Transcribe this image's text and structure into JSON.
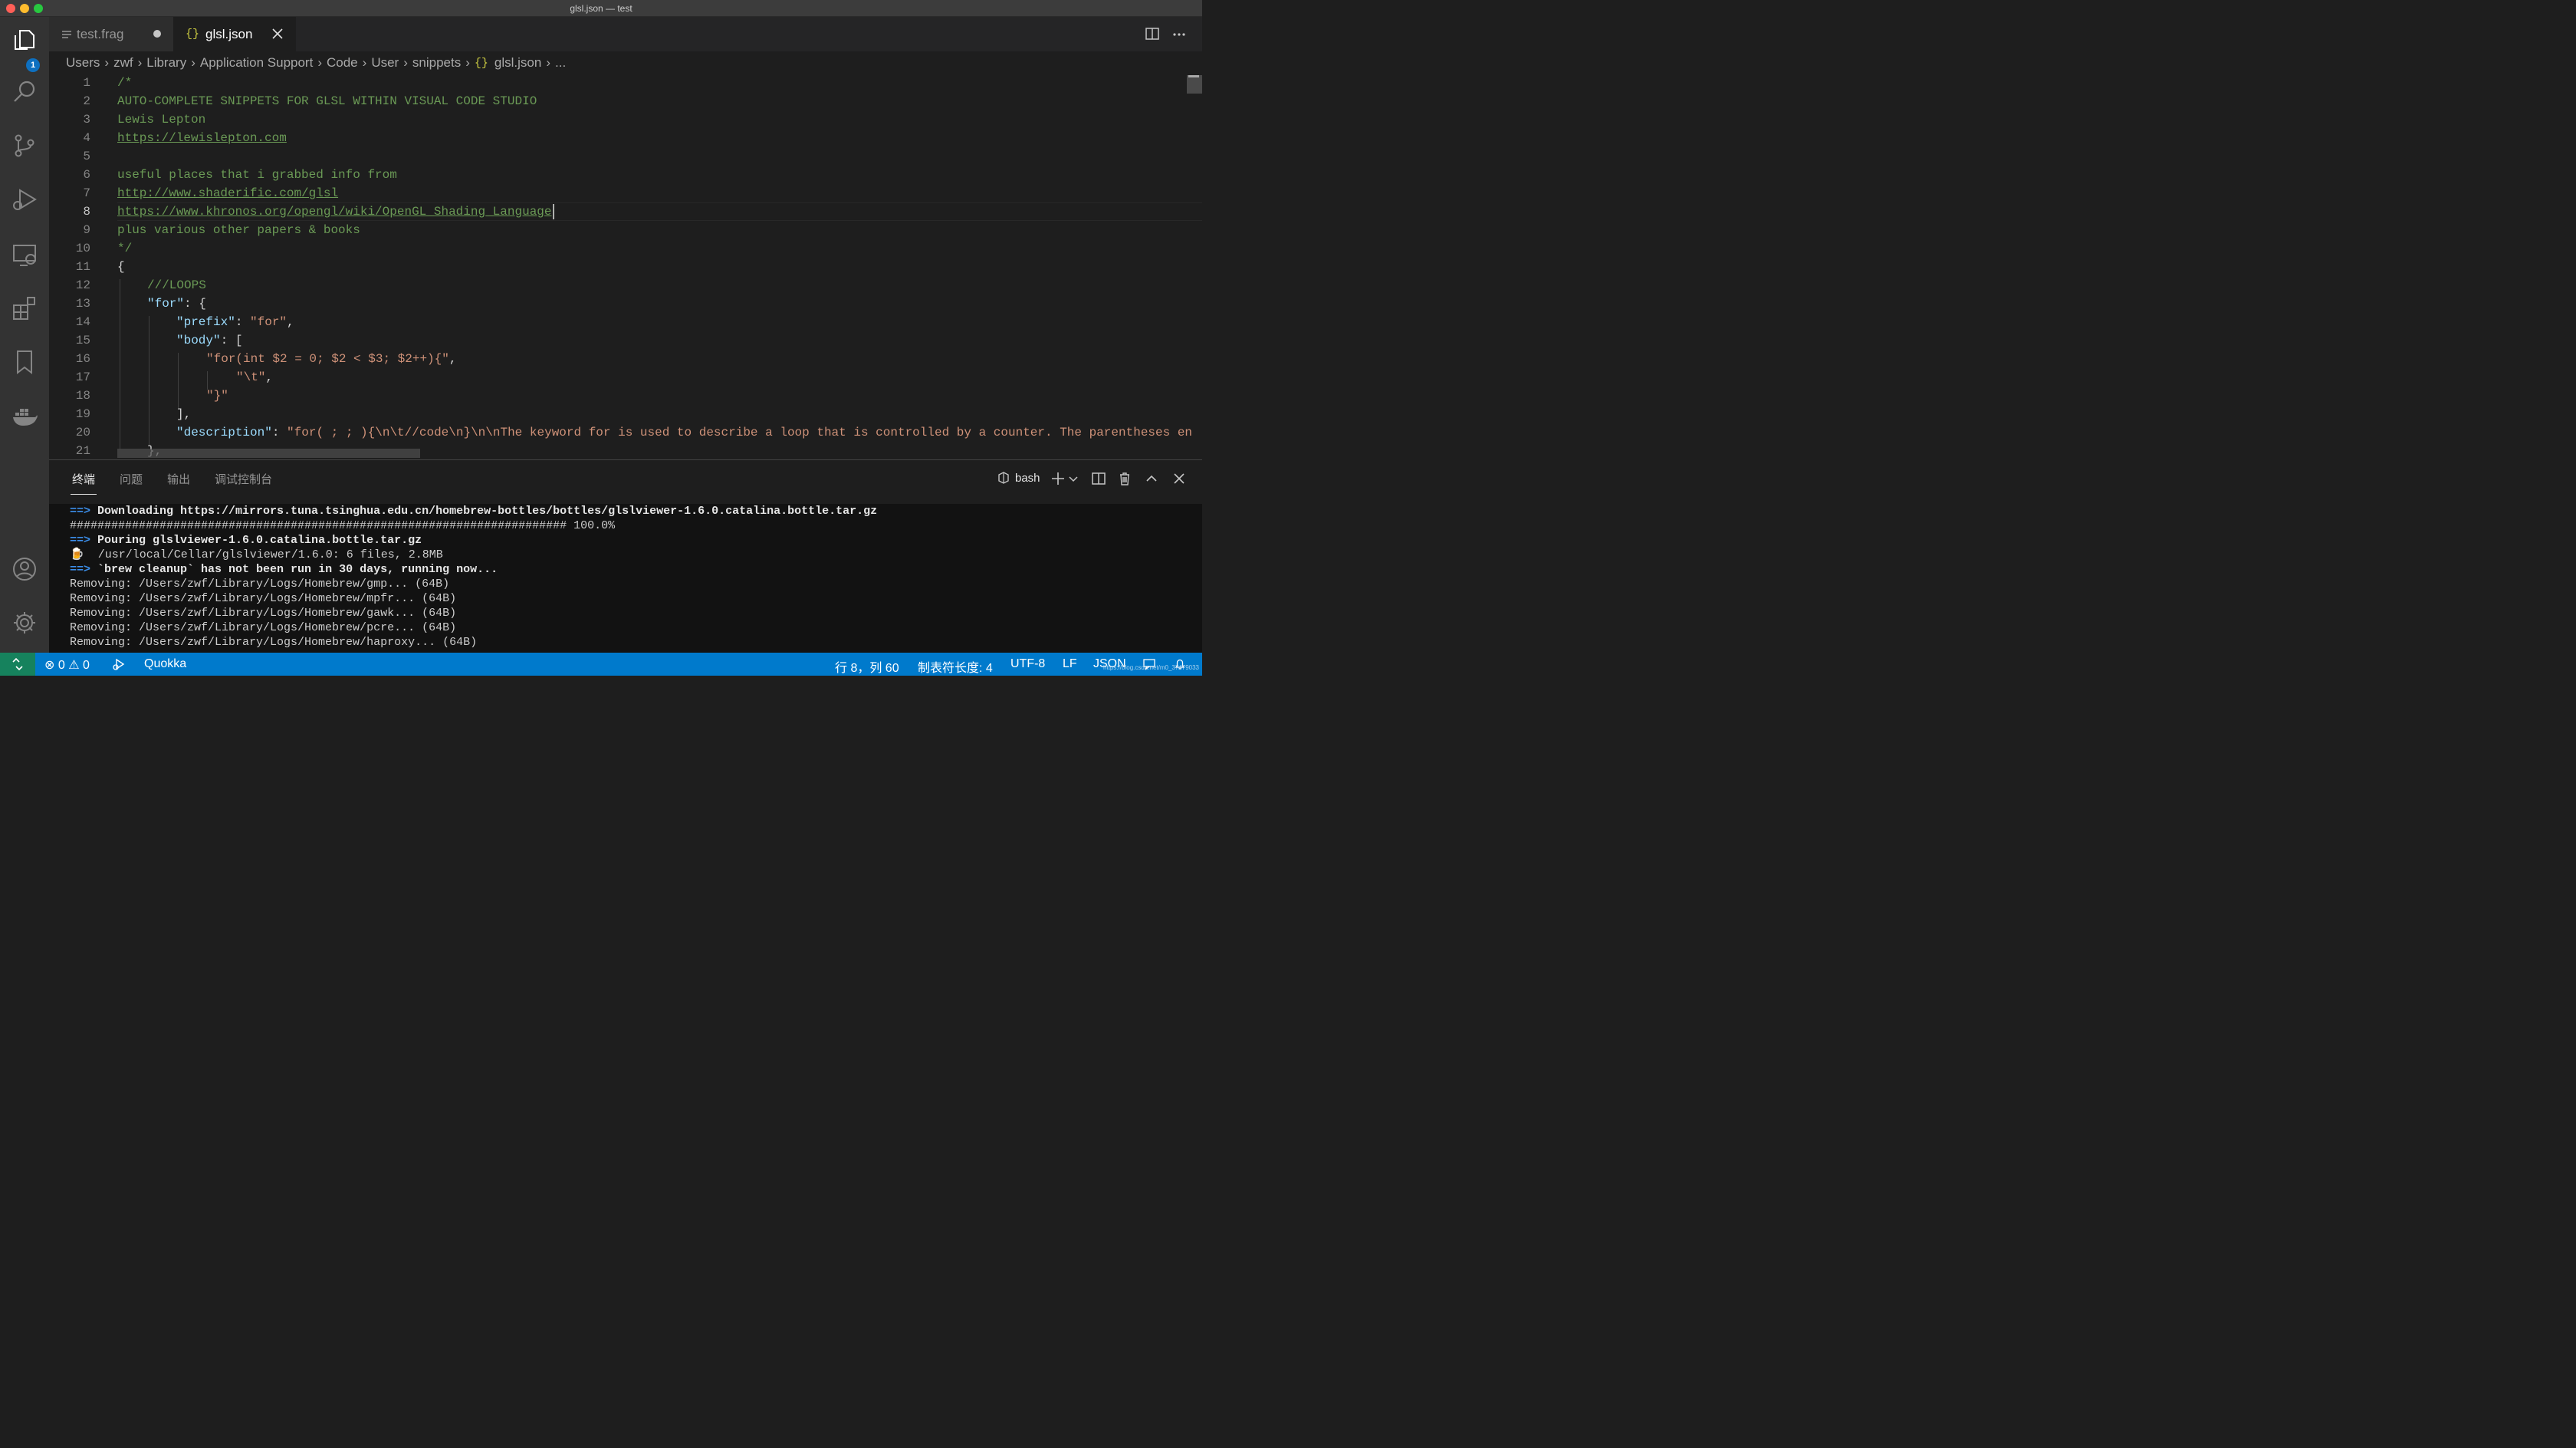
{
  "window": {
    "title": "glsl.json — test"
  },
  "activity_bar": {
    "explorer_badge": "1"
  },
  "tabs": [
    {
      "label": "test.frag",
      "icon": "lines-icon",
      "modified": true
    },
    {
      "label": "glsl.json",
      "icon": "braces-icon",
      "active": true
    }
  ],
  "breadcrumb": {
    "items": [
      "Users",
      "zwf",
      "Library",
      "Application Support",
      "Code",
      "User",
      "snippets"
    ],
    "file_icon": "{}",
    "file": "glsl.json",
    "more": "..."
  },
  "editor": {
    "line_numbers": [
      "1",
      "2",
      "3",
      "4",
      "5",
      "6",
      "7",
      "8",
      "9",
      "10",
      "11",
      "12",
      "13",
      "14",
      "15",
      "16",
      "17",
      "18",
      "19",
      "20",
      "21"
    ],
    "lines": {
      "l1": "/*",
      "l2": "AUTO-COMPLETE SNIPPETS FOR GLSL WITHIN VISUAL CODE STUDIO",
      "l3": "Lewis Lepton",
      "l4": "https://lewislepton.com",
      "l6": "useful places that i grabbed info from",
      "l7": "http://www.shaderific.com/glsl",
      "l8": "https://www.khronos.org/opengl/wiki/OpenGL_Shading_Language",
      "l9": "plus various other papers & books",
      "l10": "*/",
      "l11": "{",
      "l12": "///LOOPS",
      "l13_key": "\"for\"",
      "l13_rest": ": {",
      "l14_key": "\"prefix\"",
      "l14_sep": ": ",
      "l14_val": "\"for\"",
      "l14_end": ",",
      "l15_key": "\"body\"",
      "l15_rest": ": [",
      "l16_val": "\"for(int $2 = 0; $2 < $3; $2++){\"",
      "l16_end": ",",
      "l17_val": "\"\\t\"",
      "l17_end": ",",
      "l18_val": "\"}\"",
      "l19": "],",
      "l20_key": "\"description\"",
      "l20_sep": ": ",
      "l20_val": "\"for( ; ; ){\\n\\t//code\\n}\\n\\nThe keyword for is used to describe a loop that is controlled by a counter. The parentheses en",
      "l21": "},"
    },
    "active_line": "8"
  },
  "panel": {
    "tabs": [
      "终端",
      "问题",
      "输出",
      "调试控制台"
    ],
    "active_tab": "终端",
    "shell": "bash"
  },
  "terminal": {
    "lines": [
      {
        "prefix": "==> ",
        "text": "Downloading https://mirrors.tuna.tsinghua.edu.cn/homebrew-bottles/bottles/glslviewer-1.6.0.catalina.bottle.tar.gz",
        "bold": true
      },
      {
        "prefix": "",
        "text": "######################################################################## 100.0%",
        "bold": false
      },
      {
        "prefix": "==> ",
        "text": "Pouring glslviewer-1.6.0.catalina.bottle.tar.gz",
        "bold": true
      },
      {
        "prefix": "🍺  ",
        "text": "/usr/local/Cellar/glslviewer/1.6.0: 6 files, 2.8MB",
        "bold": false
      },
      {
        "prefix": "==> ",
        "text": "`brew cleanup` has not been run in 30 days, running now...",
        "bold": true
      },
      {
        "prefix": "",
        "text": "Removing: /Users/zwf/Library/Logs/Homebrew/gmp... (64B)",
        "bold": false
      },
      {
        "prefix": "",
        "text": "Removing: /Users/zwf/Library/Logs/Homebrew/mpfr... (64B)",
        "bold": false
      },
      {
        "prefix": "",
        "text": "Removing: /Users/zwf/Library/Logs/Homebrew/gawk... (64B)",
        "bold": false
      },
      {
        "prefix": "",
        "text": "Removing: /Users/zwf/Library/Logs/Homebrew/pcre... (64B)",
        "bold": false
      },
      {
        "prefix": "",
        "text": "Removing: /Users/zwf/Library/Logs/Homebrew/haproxy... (64B)",
        "bold": false
      }
    ]
  },
  "statusbar": {
    "errors": "0",
    "warnings": "0",
    "quokka": "Quokka",
    "position": "行 8，列 60",
    "tab_size": "制表符长度: 4",
    "encoding": "UTF-8",
    "eol": "LF",
    "language": "JSON",
    "watermark": "https://blog.csdn.net/m0_37479033"
  },
  "colors": {
    "statusbar": "#007acc",
    "remote": "#16825d",
    "comment": "#6a9955",
    "string": "#ce9178",
    "key": "#9cdcfe",
    "terminal_arrow": "#3b8eea"
  }
}
